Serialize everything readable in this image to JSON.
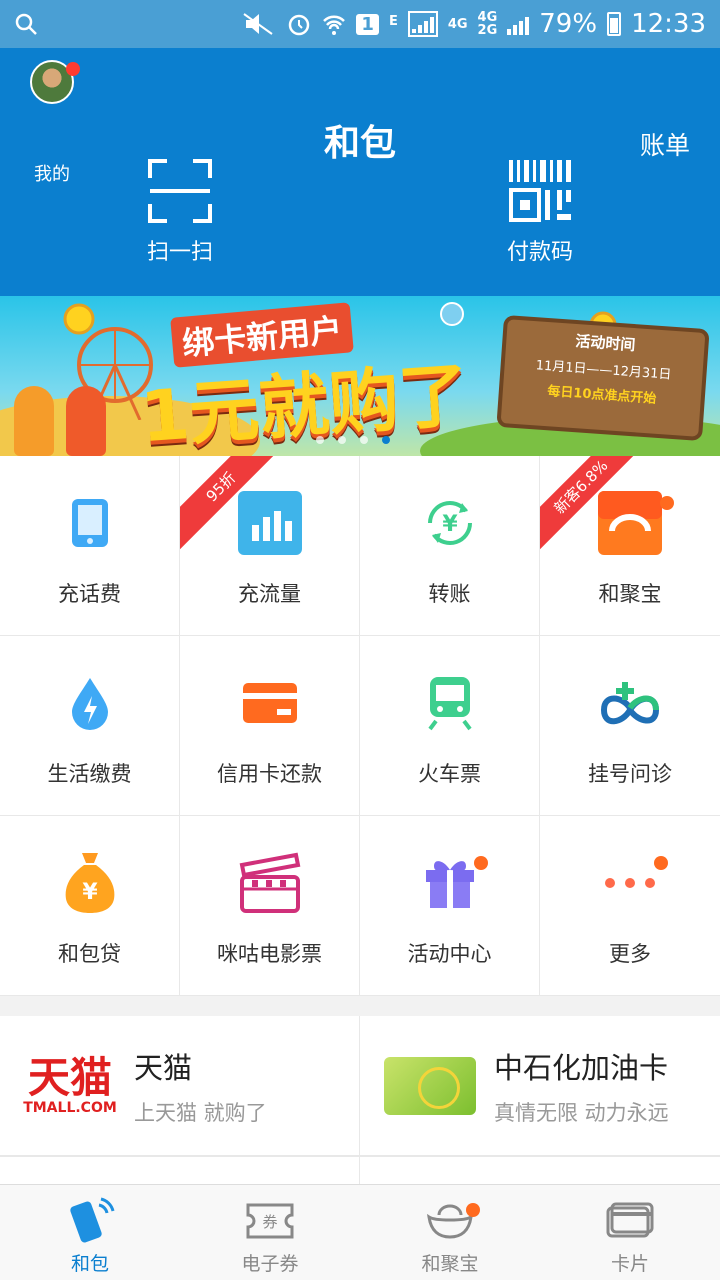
{
  "status_bar": {
    "battery": "79%",
    "time": "12:33",
    "network_a": "4G",
    "network_b": "4G",
    "network_c": "2G",
    "sim": "1",
    "e_label": "E"
  },
  "header": {
    "mine": "我的",
    "title": "和包",
    "bill": "账单",
    "scan": "扫一扫",
    "paycode": "付款码"
  },
  "banner": {
    "subtitle": "绑卡新用户",
    "headline": "1元就购了",
    "sign_title": "活动时间",
    "sign_dates": "11月1日——12月31日",
    "sign_note": "每日10点准点开始"
  },
  "services": [
    {
      "label": "充话费",
      "icon": "phone-icon"
    },
    {
      "label": "充流量",
      "icon": "data-chart-icon",
      "ribbon": "95折"
    },
    {
      "label": "转账",
      "icon": "transfer-yuan-icon"
    },
    {
      "label": "和聚宝",
      "icon": "hejubao-icon",
      "ribbon": "新客6.8%"
    },
    {
      "label": "生活缴费",
      "icon": "water-drop-icon"
    },
    {
      "label": "信用卡还款",
      "icon": "credit-card-icon"
    },
    {
      "label": "火车票",
      "icon": "train-icon"
    },
    {
      "label": "挂号问诊",
      "icon": "medical-knot-icon"
    },
    {
      "label": "和包贷",
      "icon": "money-bag-icon"
    },
    {
      "label": "咪咕电影票",
      "icon": "clapperboard-icon"
    },
    {
      "label": "活动中心",
      "icon": "gift-icon"
    },
    {
      "label": "更多",
      "icon": "more-dots-icon"
    }
  ],
  "cards": [
    {
      "logo_text": "天猫",
      "logo_sub": "TMALL.COM",
      "name": "天猫",
      "desc": "上天猫 就购了"
    },
    {
      "name": "中石化加油卡",
      "desc": "真情无限 动力永远"
    }
  ],
  "tabbar": [
    {
      "label": "和包",
      "icon": "hebao-phone-icon"
    },
    {
      "label": "电子券",
      "icon": "coupon-icon",
      "icon_text": "券"
    },
    {
      "label": "和聚宝",
      "icon": "ingot-icon"
    },
    {
      "label": "卡片",
      "icon": "cards-icon"
    }
  ],
  "colors": {
    "header_blue": "#0b7fcf",
    "status_blue": "#4a9fd4",
    "ribbon_red": "#ef3b3b",
    "dot_orange": "#ff6a1f"
  }
}
